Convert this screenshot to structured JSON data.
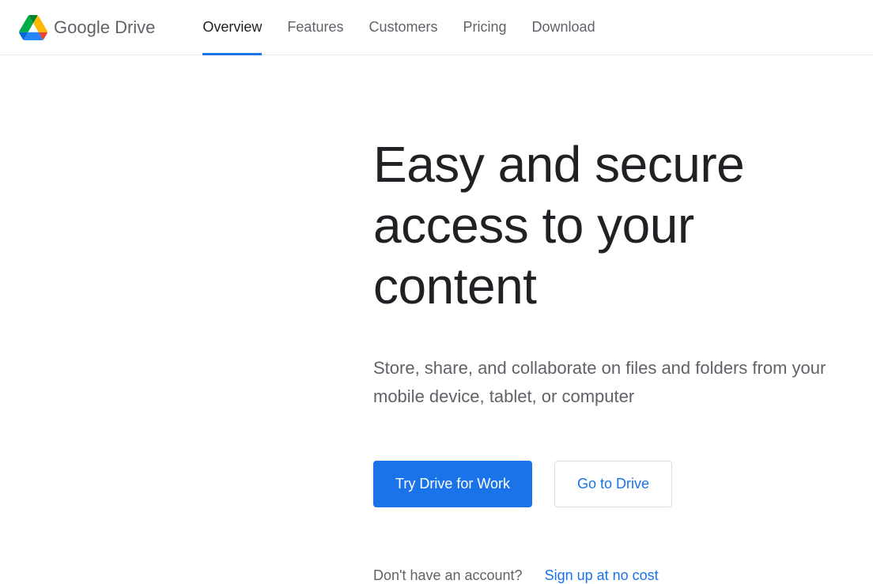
{
  "brand": {
    "name_bold": "Google",
    "name_light": " Drive"
  },
  "nav": {
    "items": [
      {
        "label": "Overview",
        "active": true
      },
      {
        "label": "Features",
        "active": false
      },
      {
        "label": "Customers",
        "active": false
      },
      {
        "label": "Pricing",
        "active": false
      },
      {
        "label": "Download",
        "active": false
      }
    ]
  },
  "hero": {
    "headline": "Easy and secure access to your content",
    "subtext": "Store, share, and collaborate on files and folders from your mobile device, tablet, or computer",
    "primary_cta": "Try Drive for Work",
    "secondary_cta": "Go to Drive",
    "signup_question": "Don't have an account?",
    "signup_link": "Sign up at no cost"
  },
  "colors": {
    "accent": "#1a73e8",
    "text_primary": "#202124",
    "text_secondary": "#5f6368",
    "border": "#dadce0"
  }
}
